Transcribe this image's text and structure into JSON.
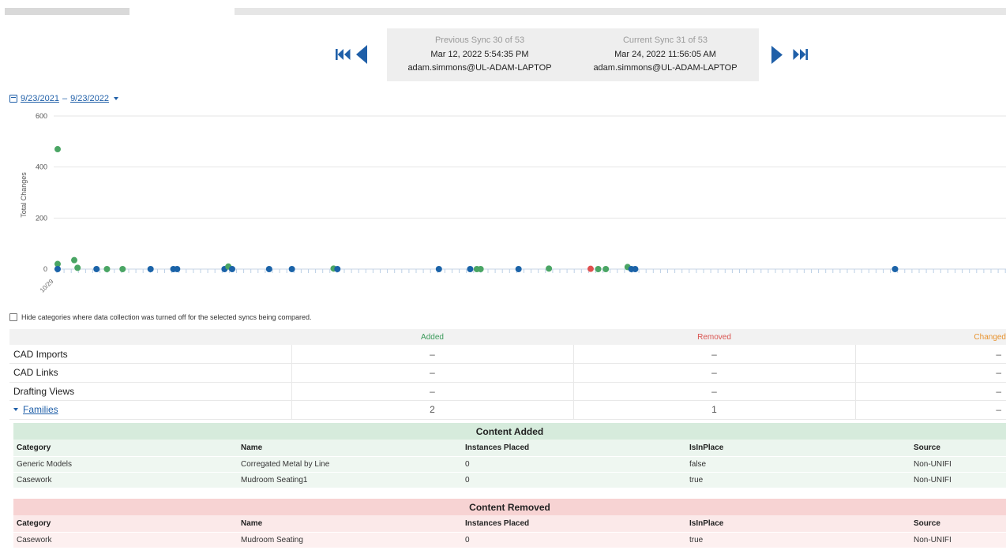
{
  "sync_nav": {
    "previous": {
      "heading": "Previous Sync 30 of 53",
      "datetime": "Mar 12, 2022 5:54:35 PM",
      "user": "adam.simmons@UL-ADAM-LAPTOP"
    },
    "current": {
      "heading": "Current Sync 31 of 53",
      "datetime": "Mar 24, 2022 11:56:05 AM",
      "user": "adam.simmons@UL-ADAM-LAPTOP"
    },
    "icons": [
      "skip-to-first-icon",
      "previous-icon",
      "next-icon",
      "skip-to-last-icon"
    ],
    "icon_color": "#1f5fa8"
  },
  "date_range": {
    "start": "9/23/2021",
    "separator": "–",
    "end": "9/23/2022"
  },
  "chart_data": {
    "type": "scatter",
    "ylabel": "Total Changes",
    "yticks": [
      "600",
      "400",
      "200",
      "0"
    ],
    "ylim": [
      0,
      600
    ],
    "xtick_label": "10/29",
    "grid": true,
    "colors": {
      "added": "#4aa564",
      "neutral": "#1b63a8",
      "removed": "#e05050"
    },
    "points": [
      {
        "x": 0.0,
        "y": 470,
        "kind": "added"
      },
      {
        "x": 0.0,
        "y": 20,
        "kind": "added"
      },
      {
        "x": 0.0,
        "y": 0,
        "kind": "neutral"
      },
      {
        "x": 1.75,
        "y": 35,
        "kind": "added"
      },
      {
        "x": 2.1,
        "y": 5,
        "kind": "added"
      },
      {
        "x": 4.1,
        "y": 0,
        "kind": "neutral"
      },
      {
        "x": 5.2,
        "y": 0,
        "kind": "added"
      },
      {
        "x": 6.85,
        "y": 0,
        "kind": "added"
      },
      {
        "x": 9.8,
        "y": 0,
        "kind": "neutral"
      },
      {
        "x": 12.2,
        "y": 0,
        "kind": "neutral"
      },
      {
        "x": 12.6,
        "y": 0,
        "kind": "neutral"
      },
      {
        "x": 17.6,
        "y": 0,
        "kind": "neutral"
      },
      {
        "x": 18.0,
        "y": 10,
        "kind": "added"
      },
      {
        "x": 18.4,
        "y": 0,
        "kind": "neutral"
      },
      {
        "x": 22.3,
        "y": 0,
        "kind": "neutral"
      },
      {
        "x": 24.7,
        "y": 0,
        "kind": "neutral"
      },
      {
        "x": 29.1,
        "y": 2,
        "kind": "added"
      },
      {
        "x": 29.5,
        "y": 0,
        "kind": "neutral"
      },
      {
        "x": 40.2,
        "y": 0,
        "kind": "neutral"
      },
      {
        "x": 43.5,
        "y": 0,
        "kind": "neutral"
      },
      {
        "x": 44.2,
        "y": 0,
        "kind": "added"
      },
      {
        "x": 44.6,
        "y": 0,
        "kind": "added"
      },
      {
        "x": 48.6,
        "y": 0,
        "kind": "neutral"
      },
      {
        "x": 51.8,
        "y": 2,
        "kind": "added"
      },
      {
        "x": 56.2,
        "y": 1,
        "kind": "removed"
      },
      {
        "x": 57.0,
        "y": 0,
        "kind": "added"
      },
      {
        "x": 57.8,
        "y": 0,
        "kind": "added"
      },
      {
        "x": 60.1,
        "y": 8,
        "kind": "added"
      },
      {
        "x": 60.5,
        "y": 0,
        "kind": "neutral"
      },
      {
        "x": 60.9,
        "y": 0,
        "kind": "neutral"
      },
      {
        "x": 88.3,
        "y": 0,
        "kind": "neutral"
      }
    ]
  },
  "hide_categories_label": "Hide categories where data collection was turned off for the selected syncs being compared.",
  "summary": {
    "headers": {
      "added": "Added",
      "removed": "Removed",
      "changed": "Changed"
    },
    "header_colors": {
      "added": "#3b9a5a",
      "removed": "#d9534f",
      "changed": "#e8932f"
    },
    "rows": [
      {
        "name": "CAD Imports",
        "added": "–",
        "removed": "–",
        "changed": "–"
      },
      {
        "name": "CAD Links",
        "added": "–",
        "removed": "–",
        "changed": "–"
      },
      {
        "name": "Drafting Views",
        "added": "–",
        "removed": "–",
        "changed": "–"
      },
      {
        "name": "Families",
        "added": "2",
        "removed": "1",
        "changed": "–"
      }
    ]
  },
  "content_added": {
    "title": "Content Added",
    "columns": [
      "Category",
      "Name",
      "Instances Placed",
      "IsInPlace",
      "Source"
    ],
    "rows": [
      [
        "Generic Models",
        "Corregated Metal by Line",
        "0",
        "false",
        "Non-UNIFI"
      ],
      [
        "Casework",
        "Mudroom Seating1",
        "0",
        "true",
        "Non-UNIFI"
      ]
    ]
  },
  "content_removed": {
    "title": "Content Removed",
    "columns": [
      "Category",
      "Name",
      "Instances Placed",
      "IsInPlace",
      "Source"
    ],
    "rows": [
      [
        "Casework",
        "Mudroom Seating",
        "0",
        "true",
        "Non-UNIFI"
      ]
    ]
  }
}
